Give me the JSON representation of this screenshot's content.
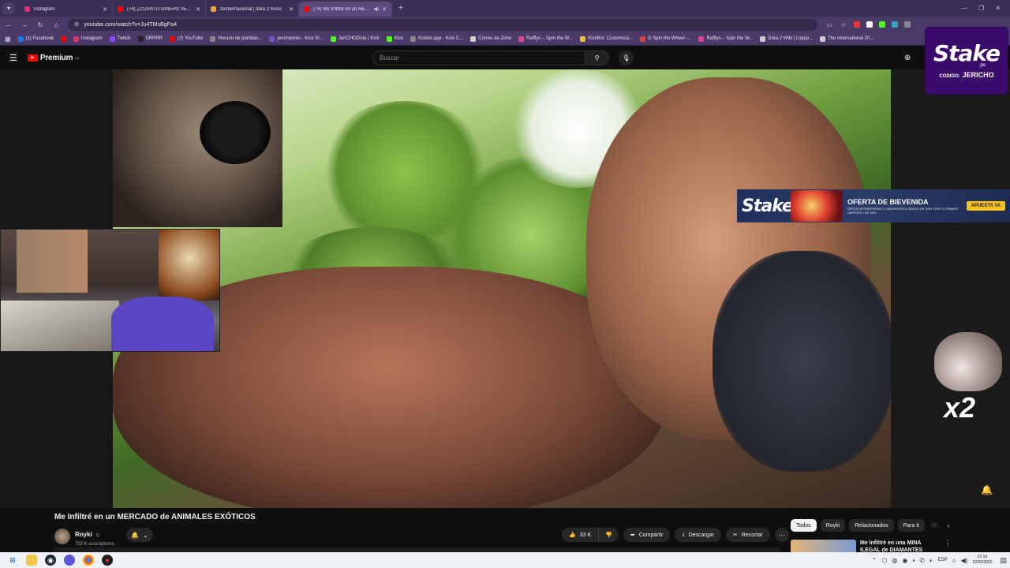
{
  "browser": {
    "tabs": [
      {
        "title": "Instagram",
        "favicon_color": "#e1306c",
        "active": false
      },
      {
        "title": "(74) ¿CUÁNTO DINERO SE GAS",
        "favicon_color": "#ff0000",
        "active": false
      },
      {
        "title": "zeinternacional | dota 2 Inicio",
        "favicon_color": "#f0a030",
        "active": false
      },
      {
        "title": "(74) Me Infiltré en un MERC",
        "favicon_color": "#ff0000",
        "active": true
      }
    ],
    "new_tab_symbol": "+",
    "url": "youtube.com/watch?v=Ju4TMsBgPa4",
    "bookmarks": [
      {
        "label": "(1) Facebook",
        "color": "#1877f2"
      },
      {
        "label": "",
        "color": "#ff0000"
      },
      {
        "label": "Instagram",
        "color": "#e1306c"
      },
      {
        "label": "Twitch",
        "color": "#9146ff"
      },
      {
        "label": "SRRRR",
        "color": "#222222"
      },
      {
        "label": "(2) YouTube",
        "color": "#ff0000"
      },
      {
        "label": "Horario de partidas...",
        "color": "#888888"
      },
      {
        "label": "jerichodoto - Kick St...",
        "color": "#6a5acd"
      },
      {
        "label": "JeriCHODota | Kick",
        "color": "#53fc18"
      },
      {
        "label": "Kick",
        "color": "#53fc18"
      },
      {
        "label": "Kicklet.app - Kick C...",
        "color": "#888888"
      },
      {
        "label": "Correo de Zoho",
        "color": "#d0d0d0"
      },
      {
        "label": "Rafflys – Spin the W...",
        "color": "#e83e8c"
      },
      {
        "label": "KickBot: Customiza...",
        "color": "#f0c030"
      },
      {
        "label": "D Spin the Wheel -...",
        "color": "#e83e3e"
      },
      {
        "label": "Rafflys – Spin the W...",
        "color": "#e83e8c"
      },
      {
        "label": "Dota 2 Wiki | Liquip...",
        "color": "#cccccc"
      },
      {
        "label": "The International 20...",
        "color": "#cccccc"
      }
    ]
  },
  "youtube": {
    "logo_text": "Premium",
    "country_code": "PE",
    "search_placeholder": "Buscar",
    "video_title": "Me Infiltré en un MERCADO de ANIMALES EXÓTICOS",
    "channel_name": "Royki",
    "verified_symbol": "⊙",
    "subscribers": "702 K suscriptores",
    "likes": "33 K",
    "share_label": "Compartir",
    "download_label": "Descargar",
    "clip_label": "Recortar",
    "chips": [
      "Todos",
      "Royki",
      "Relacionados",
      "Para ti",
      "Sh"
    ],
    "recommended_title": "Me Infiltré en una MINA ILEGAL de DIAMANTES"
  },
  "overlays": {
    "stake_badge": {
      "brand": "Stake",
      "domain": ".pe",
      "code_label": "CODIGO:",
      "code": "JERICHO"
    },
    "stake_banner": {
      "brand": "Stake",
      "title": "OFERTA DE BIEVENIDA",
      "subtitle": "OBTEN 30 FREESPINS Y UNA APUESTA GRATIS DE S/50 CON TU PRIMER DEPÓSITO DE S/50",
      "cta": "APUESTA YA"
    },
    "multiplier": "x2"
  },
  "taskbar": {
    "language": "ESP",
    "time": "01:10",
    "date": "22/09/2025"
  },
  "colors": {
    "youtube_red": "#ff0000",
    "stake_purple": "#3b0b6b",
    "browser_frame": "#4a3a68"
  }
}
